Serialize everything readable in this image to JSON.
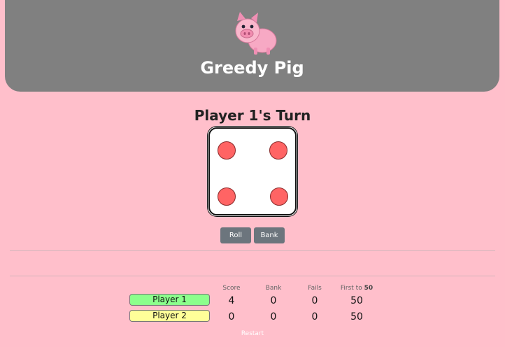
{
  "header": {
    "title": "Greedy Pig",
    "logo_icon": "pig-icon"
  },
  "turn": {
    "label": "Player 1's Turn"
  },
  "die": {
    "value": 4,
    "pip_color": "#ff6464"
  },
  "actions": {
    "roll_label": "Roll",
    "bank_label": "Bank"
  },
  "scoreboard": {
    "columns": {
      "score": "Score",
      "bank": "Bank",
      "fails": "Fails",
      "first_to_prefix": "First to",
      "first_to_value": "50"
    },
    "players": [
      {
        "name": "Player 1",
        "score": "4",
        "bank": "0",
        "fails": "0",
        "first_to": "50",
        "color": "#8cff8c"
      },
      {
        "name": "Player 2",
        "score": "0",
        "bank": "0",
        "fails": "0",
        "first_to": "50",
        "color": "#ffff99"
      }
    ]
  },
  "footer": {
    "restart_label": "Restart"
  }
}
